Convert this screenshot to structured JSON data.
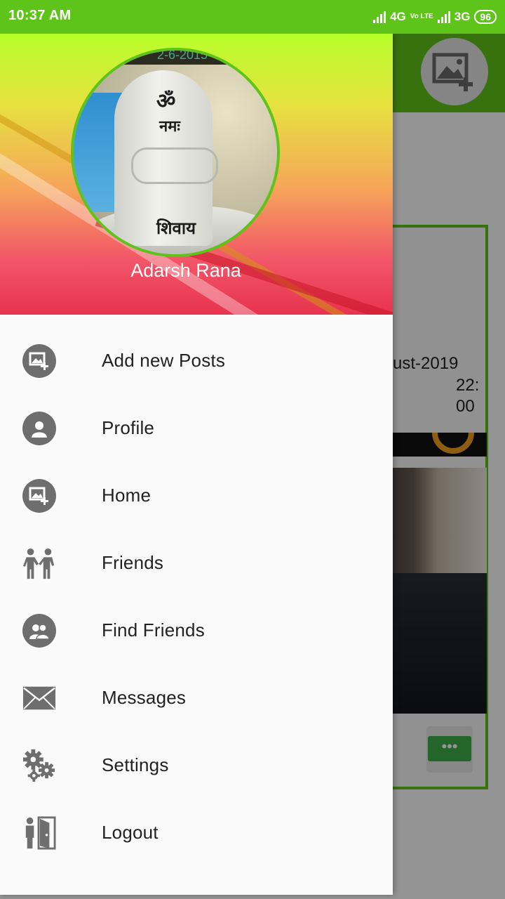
{
  "status_bar": {
    "time": "10:37 AM",
    "network_1": "4G",
    "volte": "Vo LTE",
    "network_2": "3G",
    "battery": "96"
  },
  "drawer": {
    "username": "Adarsh Rana",
    "avatar_text": {
      "line1": "ॐ",
      "line2": "नमः",
      "line3": "शिवाय",
      "top_band": "2-6-2015"
    },
    "items": [
      {
        "label": "Add new Posts",
        "icon": "add-image-icon"
      },
      {
        "label": "Profile",
        "icon": "user-icon"
      },
      {
        "label": "Home",
        "icon": "home-image-icon"
      },
      {
        "label": "Friends",
        "icon": "friends-icon"
      },
      {
        "label": "Find Friends",
        "icon": "find-friends-icon"
      },
      {
        "label": "Messages",
        "icon": "envelope-icon"
      },
      {
        "label": "Settings",
        "icon": "gears-icon"
      },
      {
        "label": "Logout",
        "icon": "logout-door-icon"
      }
    ]
  },
  "background": {
    "post_date": "ust-2019",
    "post_time": "22:00",
    "chat_glyph": "•••"
  },
  "colors": {
    "accent": "#5fc41a",
    "icon_gray": "#6e6e6e",
    "drawer_bg": "#fafafa"
  }
}
